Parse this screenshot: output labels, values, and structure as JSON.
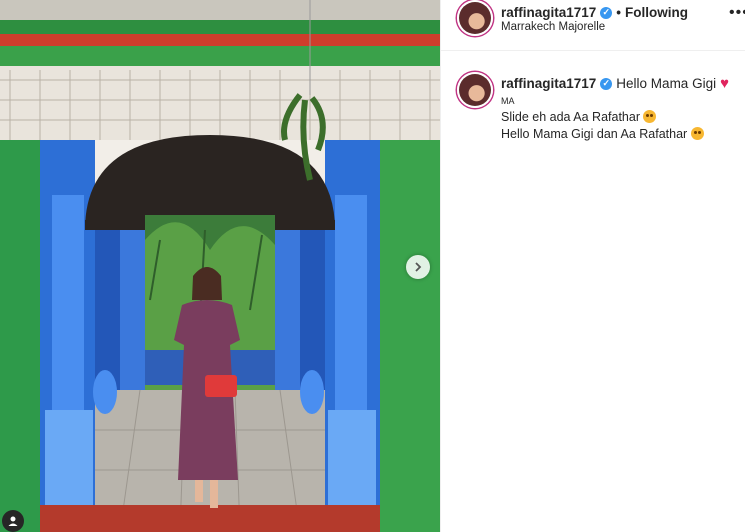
{
  "post": {
    "username": "raffinagita1717",
    "follow_separator": "•",
    "follow_status": "Following",
    "location": "Marrakech Majorelle",
    "more_label": "•••"
  },
  "caption": {
    "username": "raffinagita1717",
    "first_line": "Hello Mama Gigi",
    "second_line": "MA",
    "line3": "Slide eh ada Aa Rafathar",
    "line4": "Hello Mama Gigi dan Aa Rafathar"
  },
  "colors": {
    "majorelle_blue": "#2d6fd6",
    "green_wall": "#2e9a4a",
    "verified": "#3897f0",
    "heart": "#e0245e"
  },
  "icons": {
    "next": "chevron-right-icon",
    "tag": "person-tag-icon",
    "verified": "verified-badge-icon",
    "heart": "red-heart-icon"
  }
}
